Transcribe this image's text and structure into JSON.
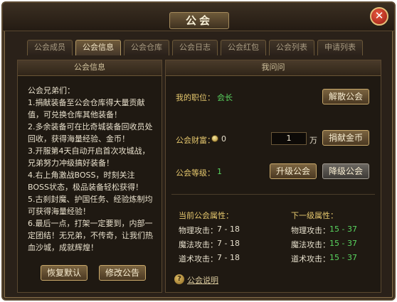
{
  "window": {
    "title": "公会",
    "close_icon": "✕"
  },
  "tabs": [
    {
      "label": "公会成员",
      "active": false
    },
    {
      "label": "公会信息",
      "active": true
    },
    {
      "label": "公会仓库",
      "active": false
    },
    {
      "label": "公会日志",
      "active": false
    },
    {
      "label": "公会红包",
      "active": false
    },
    {
      "label": "公会列表",
      "active": false
    },
    {
      "label": "申请列表",
      "active": false
    }
  ],
  "left_panel": {
    "header": "公会信息",
    "notice_lines": [
      "公会兄弟们：",
      "1.捐献装备至公会仓库得大量贡献值，可兑换仓库其他装备！",
      "2.多余装备可在比奇城装备回收员处回收，获得海量经验、金币！",
      "3.开服第4天自动开启首次攻城战，兄弟努力冲级搞好装备！",
      "4.右上角激战BOSS，时刻关注BOSS状态，极品装备轻松获得！",
      "5.古刹封魔、护国任务、经验炼制均可获得海量经验！",
      "6.最后一点，打架一定要到，内部一定团结！无兄弟，不传奇，让我们热血沙城，成就辉煌！"
    ],
    "restore_button": "恢复默认",
    "edit_button": "修改公告"
  },
  "right_panel": {
    "header": "我问问",
    "position_label": "我的职位：",
    "position_value": "会长",
    "disband_button": "解散公会",
    "wealth_label": "公会财富：",
    "wealth_value": "0",
    "donate_amount": "1",
    "donate_unit": "万",
    "donate_button": "捐献金币",
    "level_label": "公会等级：",
    "level_value": "1",
    "upgrade_button": "升级公会",
    "downgrade_button": "降级公会",
    "current_attr_title": "当前公会属性：",
    "next_attr_title": "下一级属性：",
    "current_attrs": [
      {
        "label": "物理攻击：",
        "value": "7 - 18"
      },
      {
        "label": "魔法攻击：",
        "value": "7 - 18"
      },
      {
        "label": "道术攻击：",
        "value": "7 - 18"
      }
    ],
    "next_attrs": [
      {
        "label": "物理攻击：",
        "value": "15 - 37"
      },
      {
        "label": "魔法攻击：",
        "value": "15 - 37"
      },
      {
        "label": "道术攻击：",
        "value": "15 - 37"
      }
    ],
    "help_icon": "?",
    "help_link": "公会说明"
  },
  "colors": {
    "accent_gold": "#e6c86e",
    "value_green": "#59d45f",
    "close_red": "#c8321f"
  }
}
